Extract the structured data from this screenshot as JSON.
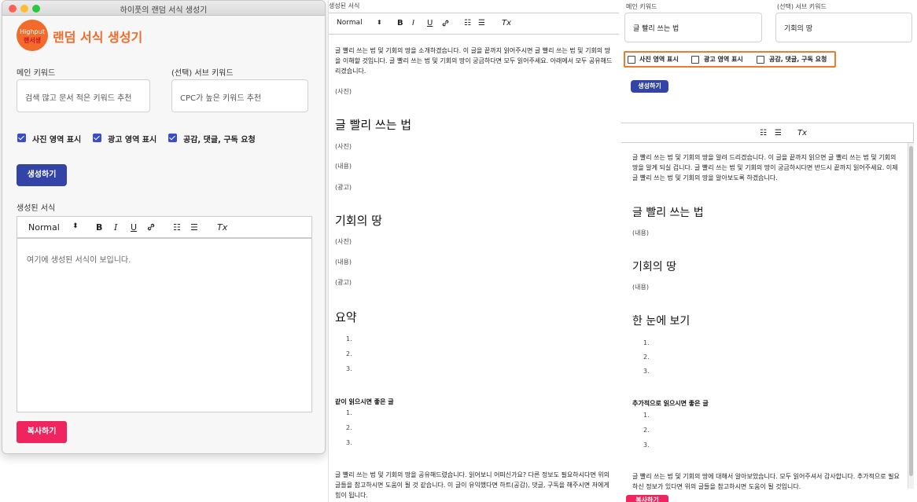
{
  "window": {
    "title": "하이풋의 랜덤 서식 생성기",
    "traffic_lights": [
      "#fe5f57",
      "#febc2e",
      "#28c840"
    ]
  },
  "app": {
    "logo_text": "Highput",
    "logo_sub": "랜서생",
    "title": "랜덤 서식 생성기",
    "brand_color": "#f26b2a"
  },
  "form": {
    "main_keyword_label": "메인 키워드",
    "main_keyword_placeholder": "검색 많고 문서 적은 키워드 추천",
    "sub_keyword_label": "(선택) 서브 키워드",
    "sub_keyword_placeholder": "CPC가 높은 키워드 추천",
    "checkboxes": [
      {
        "label": "사진 영역 표시",
        "checked": true
      },
      {
        "label": "광고 영역 표시",
        "checked": true
      },
      {
        "label": "공감, 댓글, 구독 요청",
        "checked": true
      }
    ],
    "generate_label": "생성하기",
    "result_label": "생성된 서식",
    "result_placeholder": "여기에 생성된 서식이 보입니다.",
    "copy_label": "복사하기"
  },
  "toolbar": {
    "style_select": "Normal",
    "select_arrow": "⬍",
    "bold": "B",
    "italic": "I",
    "underline": "U",
    "link_icon": "link-icon",
    "ordered_list": "☷",
    "bullet_list": "☰",
    "clear_format": "Tx"
  },
  "doc2": {
    "header_label": "생성된 서식",
    "intro": "글 빨리 쓰는 법 및 기회의 땅을 소개하겠습니다. 이 글을 끝까지 읽어주시면 글 빨리 쓰는 법 및 기회의 땅을 이해할 것입니다. 글 빨리 쓰는 법 및 기회의 땅이 궁금하다면 모두 읽어주세요. 아래에서 모두 공유해드리겠습니다.",
    "photo": "(사진)",
    "content": "(내용)",
    "ad": "(광고)",
    "h1": "글 빨리 쓰는 법",
    "h2": "기회의 땅",
    "h3": "요약",
    "list_nums": [
      "1.",
      "2.",
      "3."
    ],
    "related": "같이 읽으시면 좋은 글",
    "outro": "글 빨리 쓰는 법 및 기회의 땅을 공유해드렸습니다. 읽어보니 어떠신가요? 다른 정보도 필요하시다면 위의 글들을 참고하시면 도움이 될 것 같습니다. 이 글이 유익했다면 하트(공감), 댓글, 구독을 해주시면 저에게 힘이 됩니다."
  },
  "panel3": {
    "main_label": "메인 키워드",
    "main_value": "글 빨리 쓰는 법",
    "sub_label": "(선택) 서브 키워드",
    "sub_value": "기회의 땅",
    "checkboxes": [
      {
        "label": "사진 영역 표시",
        "checked": false
      },
      {
        "label": "광고 영역 표시",
        "checked": false
      },
      {
        "label": "공감, 댓글, 구독 요청",
        "checked": false
      }
    ],
    "generate_label": "생성하기",
    "intro": "글 빨리 쓰는 법 및 기회의 땅을 알려 드리겠습니다. 이 글을 끝까지 읽으면 글 빨리 쓰는 법 및 기회의 땅을 알게 되실 겁니다. 글 빨리 쓰는 법 및 기회의 땅이 궁금하시다면 반드시 끝까지 읽어주세요. 이제 글 빨리 쓰는 법 및 기회의 땅을 알아보도록 하겠습니다.",
    "h1": "글 빨리 쓰는 법",
    "h2": "기회의 땅",
    "h3": "한 눈에 보기",
    "content": "(내용)",
    "list_nums": [
      "1.",
      "2.",
      "3."
    ],
    "related": "추가적으로 읽으시면 좋은 글",
    "outro": "글 빨리 쓰는 법 및 기회의 땅에 대해서 알아보았습니다. 모두 읽어주셔서 감사합니다. 추가적으로 필요하신 정보가 있다면 위의 글들을 참고하시면 도움이 될 것입니다.",
    "copy_label": "복사하기",
    "highlight_color": "#ef7b2f"
  }
}
